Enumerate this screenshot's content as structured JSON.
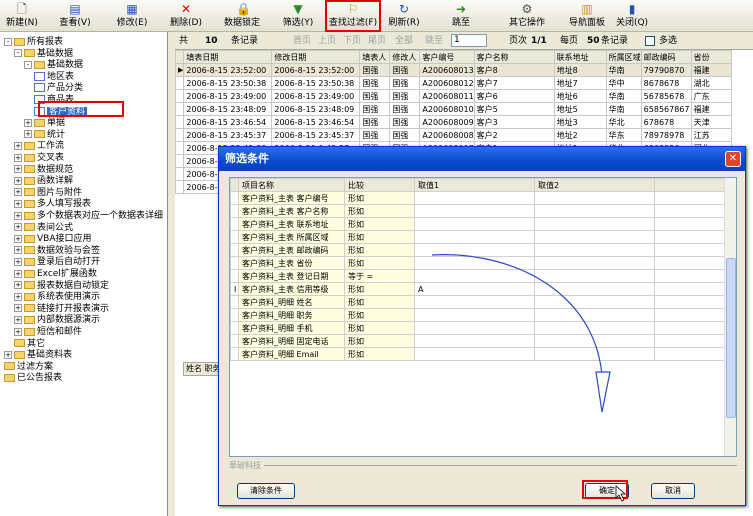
{
  "toolbar": {
    "buttons": [
      {
        "label": "新建(N)",
        "icon": "new-doc-icon",
        "glyph": "🗋"
      },
      {
        "label": "查看(V)",
        "icon": "view-icon",
        "glyph": "▤"
      },
      {
        "label": "修改(E)",
        "icon": "edit-icon",
        "glyph": "▦"
      },
      {
        "label": "删除(D)",
        "icon": "delete-icon",
        "glyph": "✕"
      },
      {
        "label": "数据锁定",
        "icon": "lock-icon",
        "glyph": "🔒"
      },
      {
        "label": "筛选(Y)",
        "icon": "filter-icon",
        "glyph": "▼"
      },
      {
        "label": "查找过滤(F)",
        "icon": "find-filter-icon",
        "glyph": "⚐"
      },
      {
        "label": "刷新(R)",
        "icon": "refresh-icon",
        "glyph": "↻"
      },
      {
        "label": "跳至",
        "icon": "goto-icon",
        "glyph": "➜"
      },
      {
        "label": "其它操作",
        "icon": "other-ops-icon",
        "glyph": "⚙"
      },
      {
        "label": "导航面板",
        "icon": "nav-panel-icon",
        "glyph": "▥"
      },
      {
        "label": "关闭(Q)",
        "icon": "close-doc-icon",
        "glyph": "▮"
      }
    ]
  },
  "tree": {
    "items": [
      "所有报表",
      "基础数据",
      "基础数据",
      "地区表",
      "产品分类",
      "商品表",
      "客户资料",
      "单据",
      "统计",
      "工作流",
      "交叉表",
      "数据规范",
      "函数详解",
      "图片与附件",
      "多人填写报表",
      "多个数据表对应一个数据表详细",
      "表间公式",
      "VBA接口应用",
      "数据效验与会签",
      "登录后自动打开",
      "Excel扩展函数",
      "报表数据自动锁定",
      "系统表使用演示",
      "链接打开报表演示",
      "内部数据源演示",
      "短信和邮件",
      "其它",
      "基础资料表",
      "过滤方案",
      "已公告报表"
    ]
  },
  "recordbar": {
    "total_label": "共",
    "total": "10",
    "records_label": "条记录",
    "first": "首页",
    "prev": "上页",
    "next": "下页",
    "last": "尾页",
    "all": "全部",
    "jump": "跳至",
    "page_no": "1",
    "page_label": "页次",
    "page": "1/1",
    "per_page_label": "每页",
    "per_page": "50",
    "per_records": "条记录",
    "multiselect": "多选"
  },
  "grid": {
    "columns": [
      "填表日期",
      "修改日期",
      "填表人",
      "修改人",
      "客户编号",
      "客户名称",
      "联系地址",
      "所属区域",
      "邮政编码",
      "省份"
    ],
    "rows": [
      [
        "2006-8-15 23:52:00",
        "2006-8-15 23:52:00",
        "国强",
        "国强",
        "A200608013",
        "客户8",
        "地址8",
        "华南",
        "79790870",
        "福建"
      ],
      [
        "2006-8-15 23:50:38",
        "2006-8-15 23:50:38",
        "国强",
        "国强",
        "A200608012",
        "客户7",
        "地址7",
        "华中",
        "8678678",
        "湖北"
      ],
      [
        "2006-8-15 23:49:00",
        "2006-8-15 23:49:00",
        "国强",
        "国强",
        "A200608011",
        "客户6",
        "地址6",
        "华南",
        "56785678",
        "广东"
      ],
      [
        "2006-8-15 23:48:09",
        "2006-8-15 23:48:09",
        "国强",
        "国强",
        "A200608010",
        "客户5",
        "地址5",
        "华南",
        "658567867",
        "福建"
      ],
      [
        "2006-8-15 23:46:54",
        "2006-8-15 23:46:54",
        "国强",
        "国强",
        "A200608009",
        "客户3",
        "地址3",
        "华北",
        "678678",
        "天津"
      ],
      [
        "2006-8-15 23:45:37",
        "2006-8-15 23:45:37",
        "国强",
        "国强",
        "A200608008",
        "客户2",
        "地址2",
        "华东",
        "78978978",
        "江苏"
      ],
      [
        "2006-8-15 23:42:30",
        "2006-8-29 0:43:57",
        "国强",
        "国强",
        "A200608007",
        "客户1",
        "地址1",
        "华北",
        "6868956",
        "河北"
      ],
      [
        "2006-8-1",
        "",
        "",
        "",
        "",
        "",
        "",
        "",
        "",
        ""
      ],
      [
        "2006-8-1",
        "",
        "",
        "",
        "",
        "",
        "",
        "",
        "",
        ""
      ],
      [
        "2006-8-1",
        "",
        "",
        "",
        "",
        "",
        "",
        "",
        "",
        ""
      ]
    ]
  },
  "subgrid": {
    "label": "姓名 职务"
  },
  "dialog": {
    "title": "筛选条件",
    "header": [
      "项目名称",
      "比较",
      "取值1",
      "取值2"
    ],
    "rows": [
      [
        "客户资料_主表 客户编号",
        "形如",
        "",
        ""
      ],
      [
        "客户资料_主表 客户名称",
        "形如",
        "",
        ""
      ],
      [
        "客户资料_主表 联系地址",
        "形如",
        "",
        ""
      ],
      [
        "客户资料_主表 所属区域",
        "形如",
        "",
        ""
      ],
      [
        "客户资料_主表 邮政编码",
        "形如",
        "",
        ""
      ],
      [
        "客户资料_主表 省份",
        "形如",
        "",
        ""
      ],
      [
        "客户资料_主表 登记日期",
        "等于 =",
        "",
        ""
      ],
      [
        "客户资料_主表 信用等级",
        "形如",
        "A",
        ""
      ],
      [
        "客户资料_明细 姓名",
        "形如",
        "",
        ""
      ],
      [
        "客户资料_明细 职务",
        "形如",
        "",
        ""
      ],
      [
        "客户资料_明细 手机",
        "形如",
        "",
        ""
      ],
      [
        "客户资料_明细 固定电话",
        "形如",
        "",
        ""
      ],
      [
        "客户资料_明细 Email",
        "形如",
        "",
        ""
      ]
    ],
    "group_label": "華破科技",
    "clear_label": "清除条件",
    "ok_label": "确定",
    "cancel_label": "取消",
    "close_glyph": "✕"
  },
  "colors": {
    "accent": "#e30000",
    "title_bar": "#0a4ad0",
    "selection": "#316ac5"
  }
}
